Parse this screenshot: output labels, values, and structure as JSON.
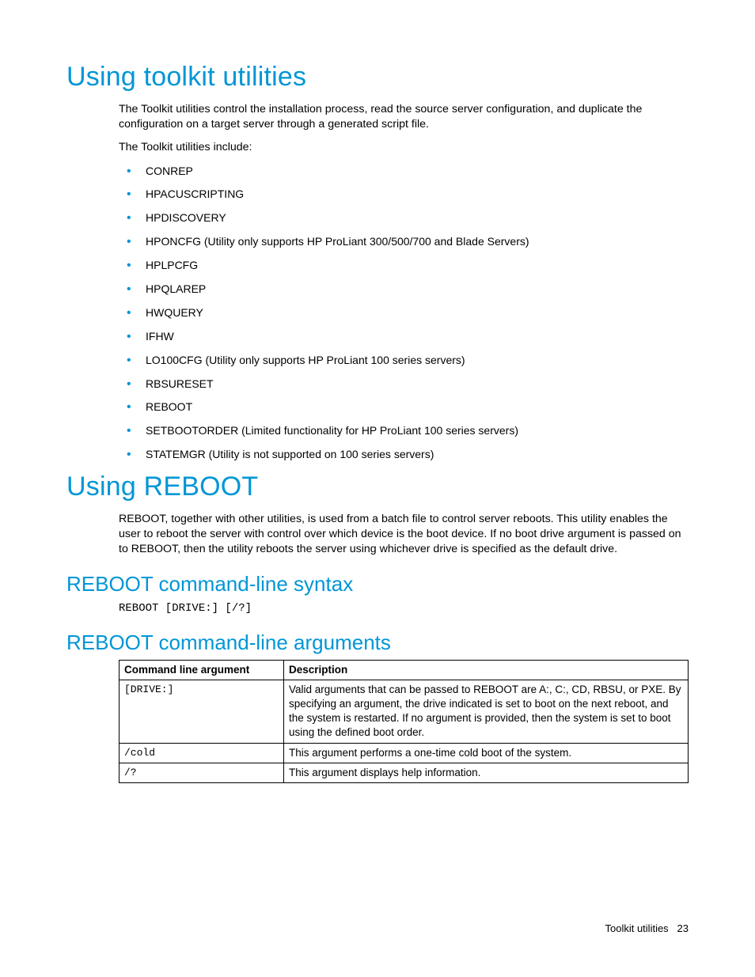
{
  "h1a": "Using toolkit utilities",
  "intro1": "The Toolkit utilities control the installation process, read the source server configuration, and duplicate the configuration on a target server through a generated script file.",
  "intro2": "The Toolkit utilities include:",
  "utilities": [
    "CONREP",
    "HPACUSCRIPTING",
    "HPDISCOVERY",
    "HPONCFG (Utility only supports HP ProLiant 300/500/700 and Blade Servers)",
    "HPLPCFG",
    "HPQLAREP",
    "HWQUERY",
    "IFHW",
    "LO100CFG (Utility only supports HP ProLiant 100 series servers)",
    "RBSURESET",
    "REBOOT",
    "SETBOOTORDER (Limited functionality for HP ProLiant 100 series servers)",
    "STATEMGR (Utility is not supported on 100 series servers)"
  ],
  "h1b": "Using REBOOT",
  "reboot_intro": "REBOOT, together with other utilities, is used from a batch file to control server reboots. This utility enables the user to reboot the server with control over which device is the boot device. If no boot drive argument is passed on to REBOOT, then the utility reboots the server using whichever drive is specified as the default drive.",
  "h2a": "REBOOT command-line syntax",
  "syntax": "REBOOT [DRIVE:] [/?]",
  "h2b": "REBOOT command-line arguments",
  "table": {
    "head_arg": "Command line argument",
    "head_desc": "Description",
    "rows": [
      {
        "arg": "[DRIVE:]",
        "desc": "Valid arguments that can be passed to REBOOT are A:, C:, CD, RBSU, or PXE. By specifying an argument, the drive indicated is set to boot on the next reboot, and the system is restarted. If no argument is provided, then the system is set to boot using the defined boot order."
      },
      {
        "arg": "/cold",
        "desc": "This argument performs a one-time cold boot of the system."
      },
      {
        "arg": "/?",
        "desc": "This argument displays help information."
      }
    ]
  },
  "footer_label": "Toolkit utilities",
  "footer_page": "23"
}
